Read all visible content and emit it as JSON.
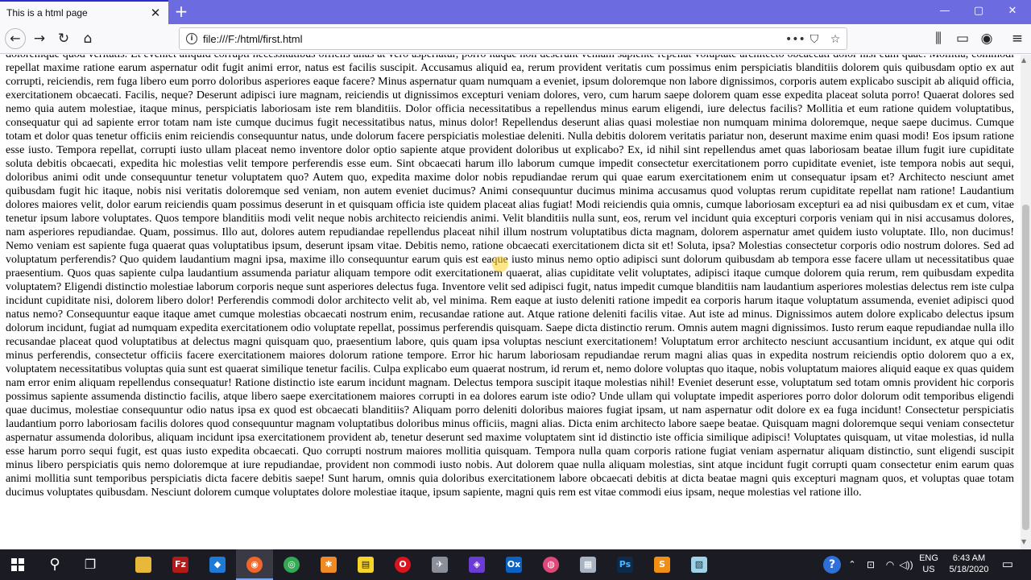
{
  "browser": {
    "tab_title": "This is a html page",
    "tab_close": "✕",
    "new_tab": "+",
    "url": "file:///F:/html/first.html",
    "icons": {
      "back": "←",
      "forward": "→",
      "reload": "↻",
      "home": "⌂",
      "info": "i",
      "more": "•••",
      "pocket": "⛉",
      "star": "☆",
      "library": "⫼",
      "sidebar": "▭",
      "account": "◉",
      "menu": "≡",
      "minimize": "—",
      "maximize": "▢",
      "close": "✕"
    }
  },
  "page": {
    "body_text": "doloremque quod veritatis. Et eveniet aliquid corrupti necessitatibus officiis alias at vero asperiatur, porro itaque non deserunt veniam sapiente repellat voluptate architecto obcaecati dolor nisi eum quae. Mollitia, commodi repellat maxime ratione earum aspernatur odit fugit animi error, natus est facilis suscipit. Accusamus aliquid ea, rerum provident veritatis cum possimus enim perspiciatis blanditiis dolorem quis quibusdam optio ex aut corrupti, reiciendis, rem fuga libero eum porro doloribus asperiores eaque facere? Minus aspernatur quam numquam a eveniet, ipsum doloremque non labore dignissimos, corporis autem explicabo suscipit ab aliquid officia, exercitationem obcaecati. Facilis, neque? Deserunt adipisci iure magnam, reiciendis ut dignissimos excepturi veniam dolores, vero, cum harum saepe dolorem quam esse expedita placeat soluta porro! Quaerat dolores sed nemo quia autem molestiae, itaque minus, perspiciatis laboriosam iste rem blanditiis. Dolor officia necessitatibus a repellendus minus earum eligendi, iure delectus facilis? Mollitia et eum ratione quidem voluptatibus, consequatur qui ad sapiente error totam nam iste cumque ducimus fugit necessitatibus natus, minus dolor! Repellendus deserunt alias quasi molestiae non numquam minima doloremque, neque saepe ducimus. Cumque totam et dolor quas tenetur officiis enim reiciendis consequuntur natus, unde dolorum facere perspiciatis molestiae deleniti. Nulla debitis dolorem veritatis pariatur non, deserunt maxime enim quasi modi! Eos ipsum ratione esse iusto. Tempora repellat, corrupti iusto ullam placeat nemo inventore dolor optio sapiente atque provident doloribus ut explicabo? Ex, id nihil sint repellendus amet quas laboriosam beatae illum fugit iure cupiditate soluta debitis obcaecati, expedita hic molestias velit tempore perferendis esse eum. Sint obcaecati harum illo laborum cumque impedit consectetur exercitationem porro cupiditate eveniet, iste tempora nobis aut sequi, doloribus animi odit unde consequuntur tenetur voluptatem quo? Autem quo, expedita maxime dolor nobis repudiandae rerum qui quae earum exercitationem enim ut consequatur ipsam et? Architecto nesciunt amet quibusdam fugit hic itaque, nobis nisi veritatis doloremque sed veniam, non autem eveniet ducimus? Animi consequuntur ducimus minima accusamus quod voluptas rerum cupiditate repellat nam ratione! Laudantium dolores maiores velit, dolor earum reiciendis quam possimus deserunt in et quisquam officia iste quidem placeat alias fugiat! Modi reiciendis quia omnis, cumque laboriosam excepturi ea ad nisi quibusdam ex et cum, vitae tenetur ipsum labore voluptates. Quos tempore blanditiis modi velit neque nobis architecto reiciendis animi. Velit blanditiis nulla sunt, eos, rerum vel incidunt quia excepturi corporis veniam qui in nisi accusamus dolores, nam asperiores repudiandae. Quam, possimus. Illo aut, dolores autem repudiandae repellendus placeat nihil illum nostrum voluptatibus dicta magnam, dolorem aspernatur amet quidem iusto voluptate. Illo, non ducimus! Nemo veniam est sapiente fuga quaerat quas voluptatibus ipsum, deserunt ipsam vitae. Debitis nemo, ratione obcaecati exercitationem dicta sit et! Soluta, ipsa? Molestias consectetur corporis odio nostrum dolores. Sed ad voluptatum perferendis? Quo quidem laudantium magni ipsa, maxime illo consequuntur earum quis est eaque iusto minus nemo optio adipisci sunt dolorum quibusdam ab tempora esse facere ullam ut necessitatibus quae praesentium. Quos quas sapiente culpa laudantium assumenda pariatur aliquam tempore odit exercitationem quaerat, alias cupiditate velit voluptates, adipisci itaque cumque dolorem quia rerum, rem quibusdam expedita voluptatem? Eligendi distinctio molestiae laborum corporis neque sunt asperiores delectus fuga. Inventore velit sed adipisci fugit, natus impedit cumque blanditiis nam laudantium asperiores molestias delectus rem iste culpa incidunt cupiditate nisi, dolorem libero dolor! Perferendis commodi dolor architecto velit ab, vel minima. Rem eaque at iusto deleniti ratione impedit ea corporis harum itaque voluptatum assumenda, eveniet adipisci quod natus nemo? Consequuntur eaque itaque amet cumque molestias obcaecati nostrum enim, recusandae ratione aut. Atque ratione deleniti facilis vitae. Aut iste ad minus. Dignissimos autem dolore explicabo delectus ipsum dolorum incidunt, fugiat ad numquam expedita exercitationem odio voluptate repellat, possimus perferendis quisquam. Saepe dicta distinctio rerum. Omnis autem magni dignissimos. Iusto rerum eaque repudiandae nulla illo recusandae placeat quod voluptatibus at delectus magni quisquam quo, praesentium labore, quis quam ipsa voluptas nesciunt exercitationem! Voluptatum error architecto nesciunt accusantium incidunt, ex atque qui odit minus perferendis, consectetur officiis facere exercitationem maiores dolorum ratione tempore. Error hic harum laboriosam repudiandae rerum magni alias quas in expedita nostrum reiciendis optio dolorem quo a ex, voluptatem necessitatibus voluptas quia sunt est quaerat similique tenetur facilis. Culpa explicabo eum quaerat nostrum, id rerum et, nemo dolore voluptas quo itaque, nobis voluptatum maiores aliquid eaque ex quas quidem nam error enim aliquam repellendus consequatur! Ratione distinctio iste earum incidunt magnam. Delectus tempora suscipit itaque molestias nihil! Eveniet deserunt esse, voluptatum sed totam omnis provident hic corporis possimus sapiente assumenda distinctio facilis, atque libero saepe exercitationem maiores corrupti in ea dolores earum iste odio? Unde ullam qui voluptate impedit asperiores porro dolor dolorum odit temporibus eligendi quae ducimus, molestiae consequuntur odio natus ipsa ex quod est obcaecati blanditiis? Aliquam porro deleniti doloribus maiores fugiat ipsam, ut nam aspernatur odit dolore ex ea fuga incidunt! Consectetur perspiciatis laudantium porro laboriosam facilis dolores quod consequuntur magnam voluptatibus doloribus minus officiis, magni alias. Dicta enim architecto labore saepe beatae. Quisquam magni doloremque sequi veniam consectetur aspernatur assumenda doloribus, aliquam incidunt ipsa exercitationem provident ab, tenetur deserunt sed maxime voluptatem sint id distinctio iste officia similique adipisci! Voluptates quisquam, ut vitae molestias, id nulla esse harum porro sequi fugit, est quas iusto expedita obcaecati. Quo corrupti nostrum maiores mollitia quisquam. Tempora nulla quam corporis ratione fugiat veniam aspernatur aliquam distinctio, sunt eligendi suscipit minus libero perspiciatis quis nemo doloremque at iure repudiandae, provident non commodi iusto nobis. Aut dolorem quae nulla aliquam molestias, sint atque incidunt fugit corrupti quam consectetur enim earum quas animi mollitia sunt temporibus perspiciatis dicta facere debitis saepe! Sunt harum, omnis quia doloribus exercitationem labore obcaecati debitis at dicta beatae magni quis excepturi magnam quos, et voluptas quae totam ducimus voluptates quibusdam. Nesciunt dolorem cumque voluptates dolore molestiae itaque, ipsum sapiente, magni quis rem est vitae commodi eius ipsam, neque molestias vel ratione illo."
  },
  "taskbar": {
    "icons": {
      "search": "⚲",
      "taskview": "❐",
      "filezilla": "Fz",
      "vscode": "◆",
      "firefox": "◉",
      "chrome": "◎",
      "app_orange": "✱",
      "notes": "▤",
      "opera": "O",
      "app_bird": "✈",
      "app_purple": "◈",
      "outlook": "Ox",
      "app_circle": "◍",
      "app_gray": "▦",
      "photoshop": "Ps",
      "sublime": "S",
      "app_light": "▧",
      "help": "?",
      "chevron": "⌃",
      "network": "⊡",
      "wifi": "◠",
      "volume": "◁))",
      "notifications": "▭"
    },
    "lang_line1": "ENG",
    "lang_line2": "US",
    "time": "6:43 AM",
    "date": "5/18/2020",
    "colors": {
      "tab_strip": "#6c6ce0",
      "taskbar": "#1b1b23"
    }
  }
}
